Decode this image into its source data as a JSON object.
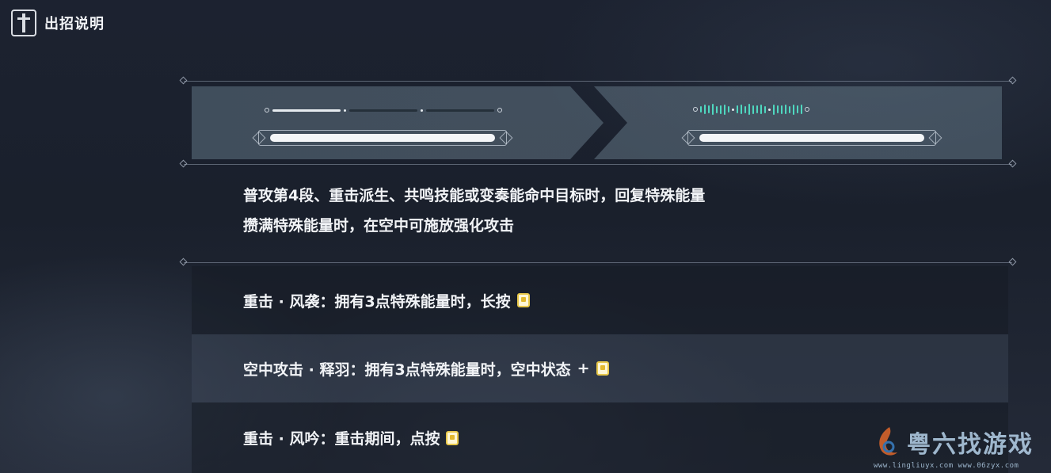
{
  "header": {
    "title": "出招说明",
    "icon": "sword-icon"
  },
  "demo": {
    "left": {
      "segments_filled": 1,
      "segments_total": 3,
      "bar_fill": 1.0
    },
    "right": {
      "segments_filled": 3,
      "segments_total": 3,
      "bar_fill": 1.0,
      "accent_color": "#4fd8c0"
    }
  },
  "description": {
    "line1": "普攻第4段、重击派生、共鸣技能或变奏能命中目标时，回复特殊能量",
    "line2": "攒满特殊能量时，在空中可施放强化攻击"
  },
  "skills": [
    {
      "text": "重击 · 风袭：拥有3点特殊能量时，长按",
      "has_plus": false,
      "icon": "attack-key-icon"
    },
    {
      "text": "空中攻击 · 释羽：拥有3点特殊能量时，空中状态",
      "has_plus": true,
      "plus": "+",
      "icon": "attack-key-icon"
    },
    {
      "text": "重击 · 风吟：重击期间，点按",
      "has_plus": false,
      "icon": "attack-key-icon"
    }
  ],
  "watermark": {
    "text": "粤六找游戏",
    "sub": "www.lingliuyx.com   www.06zyx.com"
  },
  "colors": {
    "accent_teal": "#4fd8c0",
    "key_yellow": "#e8c84a"
  }
}
